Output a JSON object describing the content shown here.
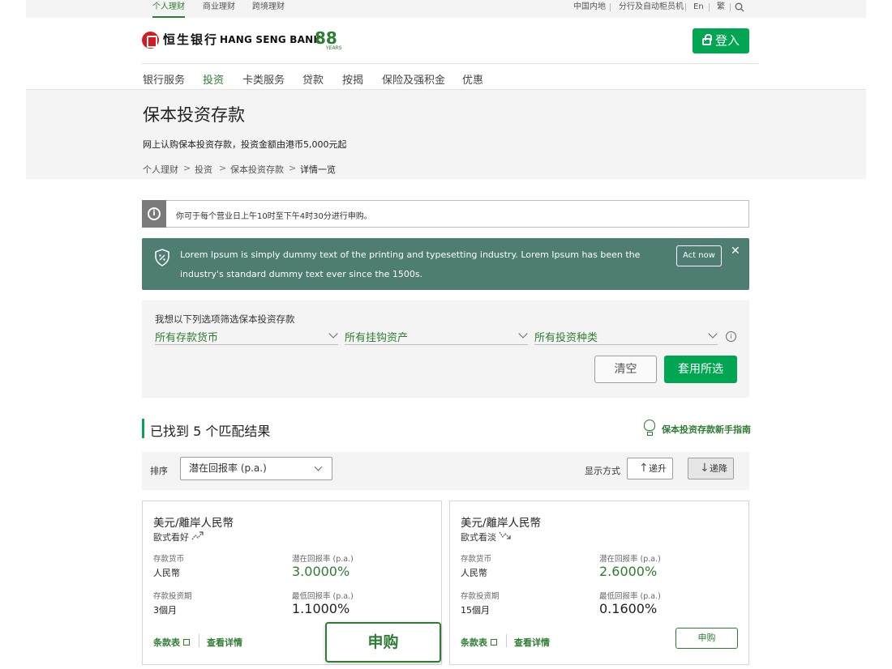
{
  "top_tabs": [
    "个人理财",
    "商业理财",
    "跨境理财"
  ],
  "utility_links": [
    "中国内地",
    "分行及自动柜员机",
    "En",
    "繁"
  ],
  "logo": {
    "cn": "恒生银行",
    "en": "HANG SENG BANK",
    "anniversary": "88",
    "years": "YEARS"
  },
  "login_label": "登入",
  "nav": [
    "银行服务",
    "投资",
    "卡类服务",
    "贷款",
    "按揭",
    "保险及强积金",
    "优惠"
  ],
  "page": {
    "title": "保本投资存款",
    "subtitle": "网上认购保本投资存款，投资金额由港币5,000元起",
    "breadcrumb": [
      "个人理财",
      "投资",
      "保本投资存款",
      "详情一览"
    ]
  },
  "notice": {
    "text": "你可于每个营业日上午10时至下午4时30分进行申购。"
  },
  "banner": {
    "text": "Lorem Ipsum is simply dummy text of the printing and typesetting industry. Lorem Ipsum has been the industry's standard dummy text ever since the 1500s.",
    "action": "Act now"
  },
  "filter": {
    "label": "我想以下列选项筛选保本投资存款",
    "currency": "所有存款货币",
    "asset": "所有挂钩资产",
    "type": "所有投资种类",
    "clear": "清空",
    "apply": "套用所选"
  },
  "results": {
    "title": "已找到 5 个匹配结果",
    "guide": "保本投资存款新手指南"
  },
  "sort": {
    "label": "排序",
    "selected": "潜在回报率 (p.a.)",
    "display_label": "显示方式",
    "asc": "递升",
    "desc": "递降"
  },
  "cards": [
    {
      "title": "美元/離岸人民幣",
      "view": "歐式看好",
      "currency_label": "存款货币",
      "currency": "人民幣",
      "potential_label": "潜在回报率 (p.a.)",
      "potential": "3.0000%",
      "period_label": "存款投资期",
      "period": "3個月",
      "min_label": "最低回报率 (p.a.)",
      "min": "1.1000%",
      "terms": "条款表",
      "details": "查看详情",
      "subscribe": "申购"
    },
    {
      "title": "美元/離岸人民幣",
      "view": "歐式看淡",
      "currency_label": "存款货币",
      "currency": "人民幣",
      "potential_label": "潜在回报率 (p.a.)",
      "potential": "2.6000%",
      "period_label": "存款投资期",
      "period": "15個月",
      "min_label": "最低回报率 (p.a.)",
      "min": "0.1600%",
      "terms": "条款表",
      "details": "查看详情",
      "subscribe": "申购"
    }
  ],
  "floating_subscribe": "申购",
  "colors": {
    "brand_green": "#00a651",
    "text_green": "#2e7d32",
    "banner": "#4e7d72",
    "logo_red": "#d71920"
  }
}
